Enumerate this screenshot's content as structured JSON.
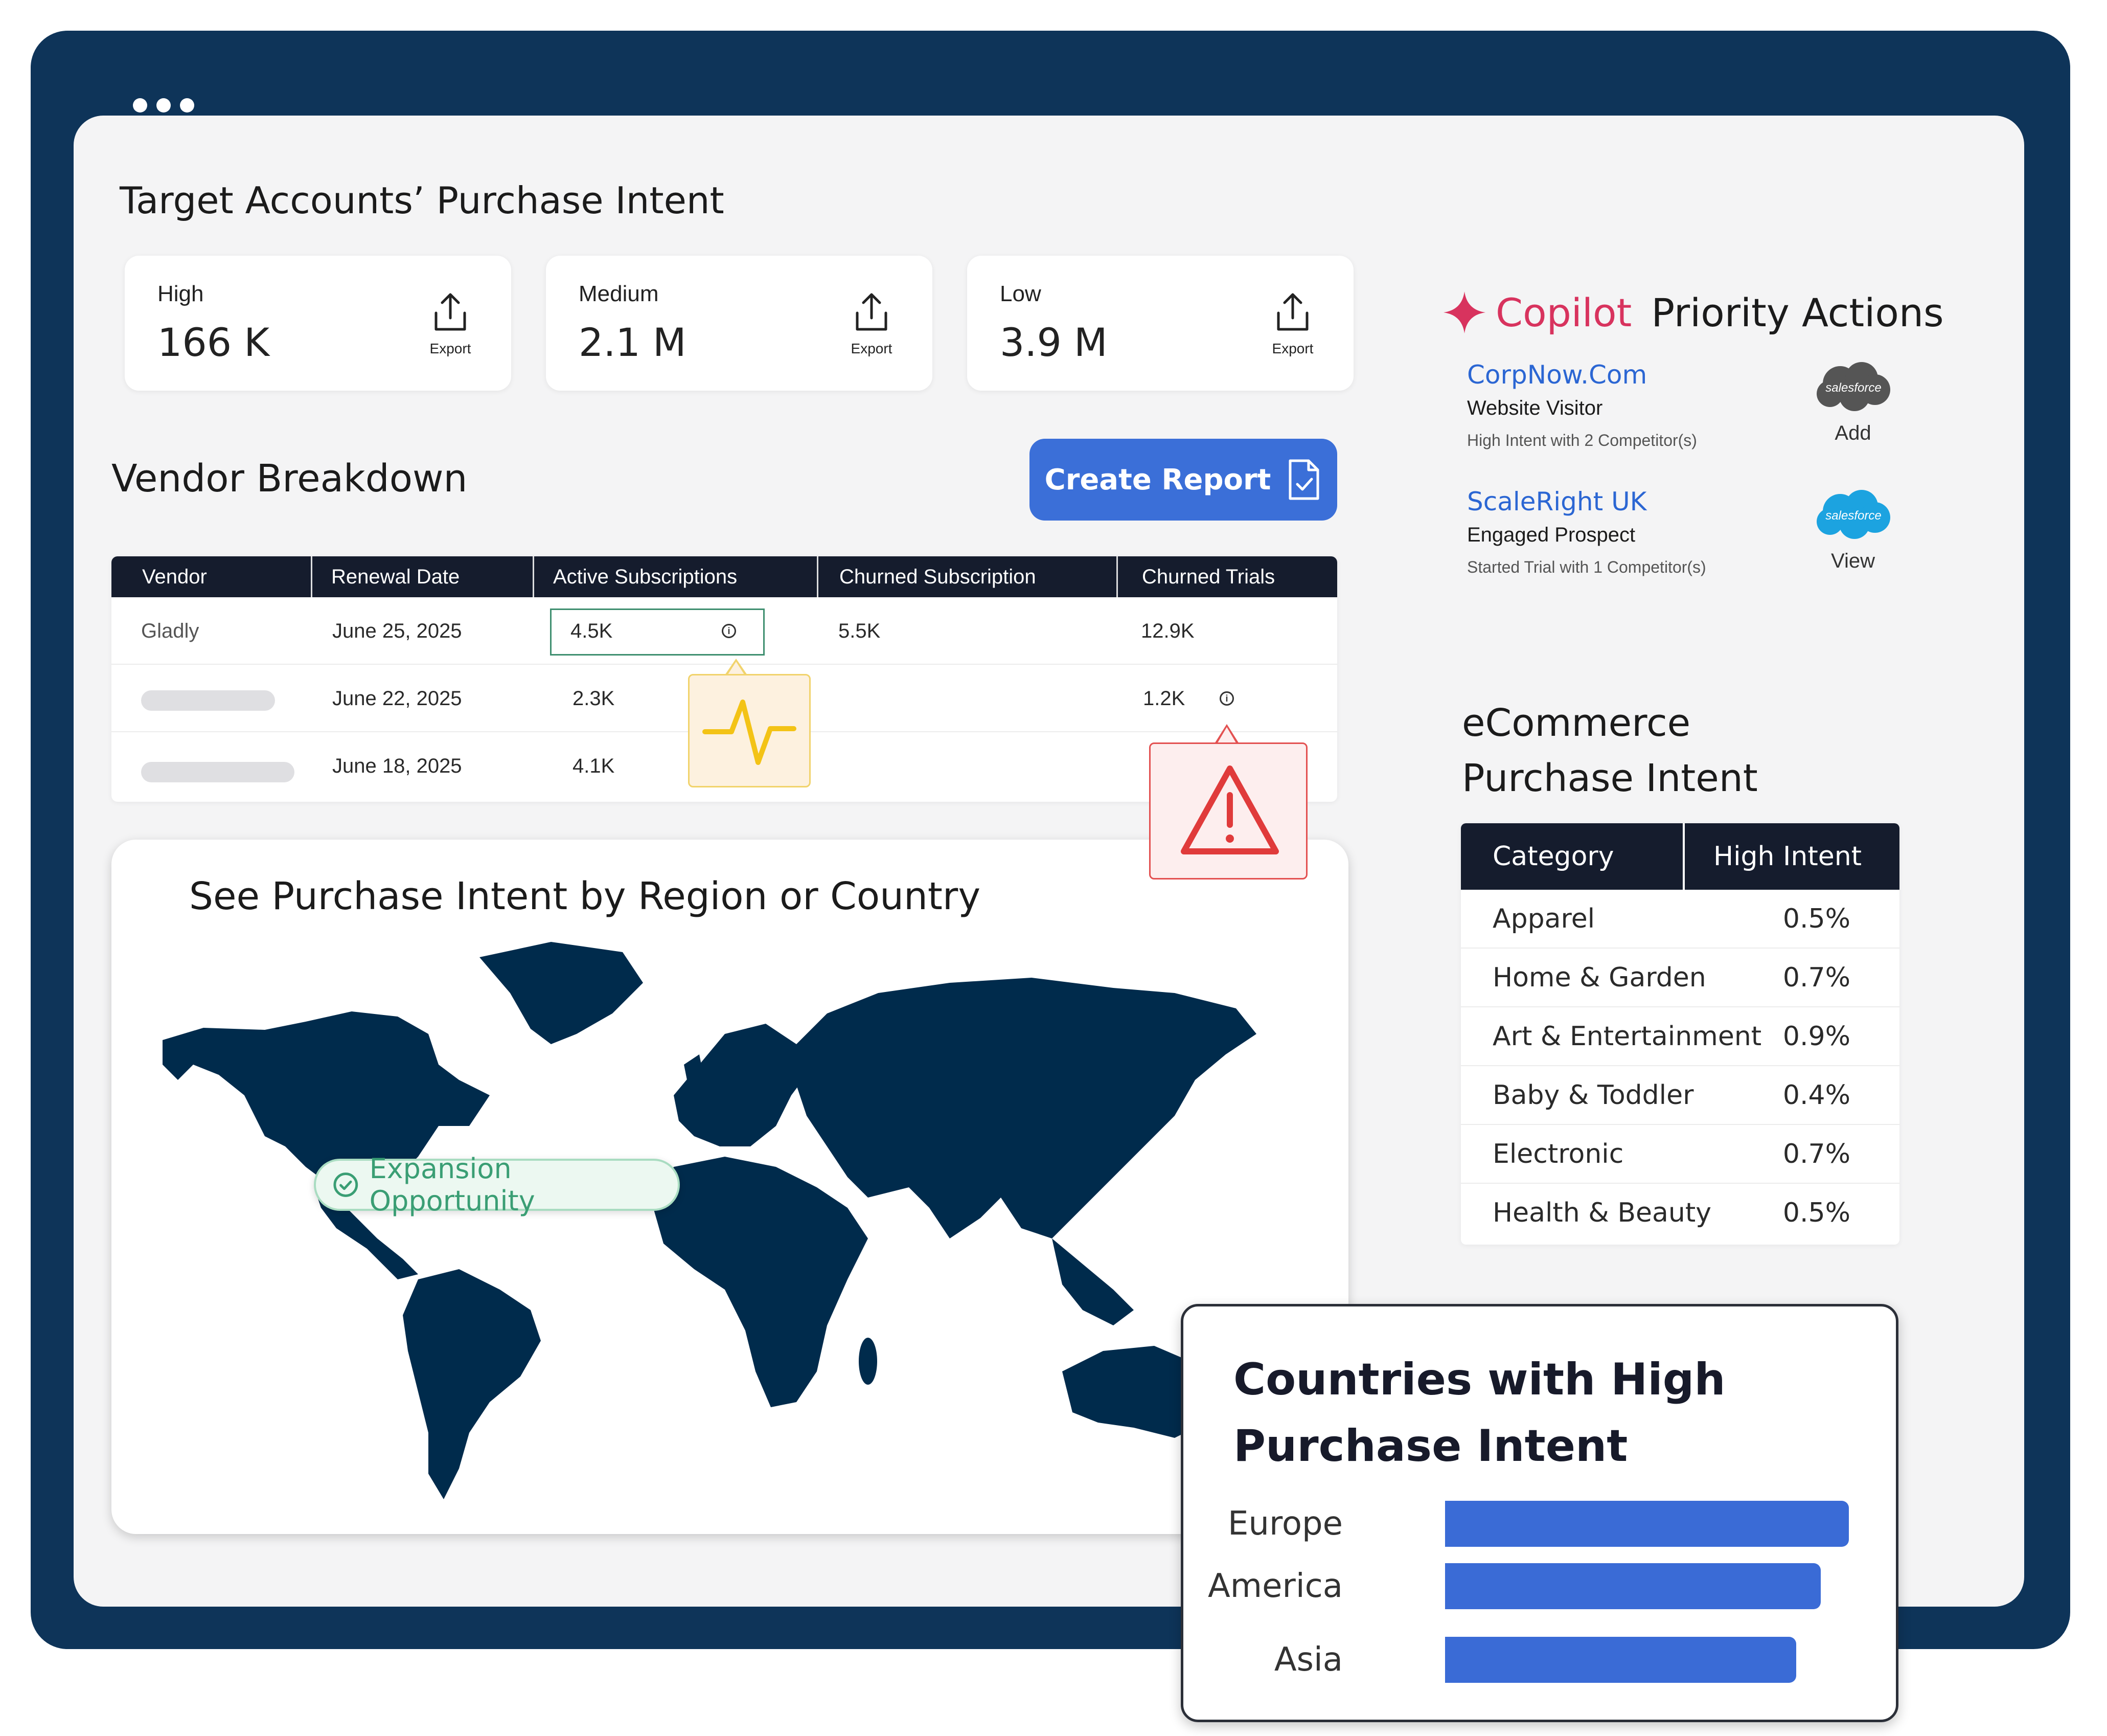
{
  "window": {
    "title": ""
  },
  "purchase_intent": {
    "title": "Target Accounts’ Purchase Intent",
    "export_label": "Export",
    "stats": [
      {
        "label": "High",
        "value": "166 K"
      },
      {
        "label": "Medium",
        "value": "2.1 M"
      },
      {
        "label": "Low",
        "value": "3.9 M"
      }
    ]
  },
  "vendor_breakdown": {
    "title": "Vendor Breakdown",
    "create_report_label": "Create Report",
    "columns": [
      "Vendor",
      "Renewal Date",
      "Active Subscriptions",
      "Churned Subscription",
      "Churned Trials"
    ],
    "rows": [
      {
        "vendor": "Gladly",
        "renewal": "June 25, 2025",
        "active": "4.5K",
        "churned_sub": "5.5K",
        "churned_trials": "12.9K"
      },
      {
        "vendor": "",
        "renewal": "June 22, 2025",
        "active": "2.3K",
        "churned_sub": "",
        "churned_trials": "1.2K"
      },
      {
        "vendor": "",
        "renewal": "June 18, 2025",
        "active": "4.1K",
        "churned_sub": "",
        "churned_trials": ""
      }
    ]
  },
  "map": {
    "title": "See Purchase Intent by Region or Country",
    "expansion_label": "Expansion Opportunity",
    "map_color": "#002b4c"
  },
  "copilot": {
    "brand": "Copilot",
    "title": "Priority Actions",
    "brand_color": "#d8335e",
    "actions": [
      {
        "company": "CorpNow.Com",
        "type": "Website Visitor",
        "detail": "High Intent with 2 Competitor(s)",
        "crm": "salesforce",
        "action": "Add",
        "crm_color": "#555555"
      },
      {
        "company": "ScaleRight UK",
        "type": "Engaged Prospect",
        "detail": "Started Trial with 1 Competitor(s)",
        "crm": "salesforce",
        "action": "View",
        "crm_color": "#1ca3e0"
      }
    ]
  },
  "ecommerce": {
    "title_line1": "eCommerce",
    "title_line2": "Purchase Intent",
    "columns": [
      "Category",
      "High Intent"
    ],
    "rows": [
      {
        "category": "Apparel",
        "value": "0.5%"
      },
      {
        "category": "Home & Garden",
        "value": "0.7%"
      },
      {
        "category": "Art & Entertainment",
        "value": "0.9%"
      },
      {
        "category": "Baby & Toddler",
        "value": "0.4%"
      },
      {
        "category": "Electronic",
        "value": "0.7%"
      },
      {
        "category": "Health & Beauty",
        "value": "0.5%"
      }
    ]
  },
  "countries": {
    "title_line1": "Countries with High",
    "title_line2": "Purchase Intent",
    "bar_color": "#3a6bd6",
    "bars": [
      {
        "label": "Europe",
        "value": 1.0
      },
      {
        "label": "America",
        "value": 0.93
      },
      {
        "label": "Asia",
        "value": 0.87
      }
    ]
  },
  "icons": [
    "export-icon",
    "document-check-icon",
    "info-icon",
    "pulse-icon",
    "warning-icon",
    "sparkle-icon",
    "salesforce-icon",
    "check-circle-icon"
  ]
}
